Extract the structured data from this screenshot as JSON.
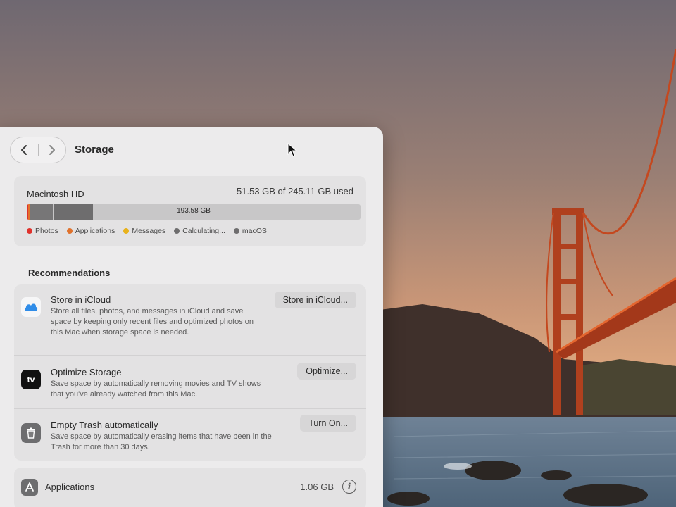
{
  "window": {
    "title": "Storage",
    "nav_back": "‹",
    "nav_forward": "›"
  },
  "disk": {
    "name": "Macintosh HD",
    "used_text": "51.53 GB of 245.11 GB used",
    "bar_label": "193.58 GB",
    "segments": [
      {
        "name": "Photos",
        "color": "#e0322c",
        "fraction": 0.004
      },
      {
        "name": "Applications",
        "color": "#e0722c",
        "fraction": 0.004
      },
      {
        "name": "Calculating…",
        "color": "#777677",
        "fraction": 0.073
      },
      {
        "name": "macOS",
        "color": "#6e6d6e",
        "fraction": 0.121
      }
    ],
    "legend": [
      {
        "label": "Photos",
        "color": "#e0322c"
      },
      {
        "label": "Applications",
        "color": "#e0722c"
      },
      {
        "label": "Messages",
        "color": "#e8b21c"
      },
      {
        "label": "Calculating...",
        "color": "#6e6d6e"
      },
      {
        "label": "macOS",
        "color": "#6e6d6e"
      }
    ]
  },
  "recommendations": {
    "title": "Recommendations",
    "items": [
      {
        "title": "Store in iCloud",
        "description": "Store all files, photos, and messages in iCloud and save space by keeping only recent files and optimized photos on this Mac when storage space is needed.",
        "button": "Store in iCloud...",
        "icon": "icloud-icon"
      },
      {
        "title": "Optimize Storage",
        "description": "Save space by automatically removing movies and TV shows that you've already watched from this Mac.",
        "button": "Optimize...",
        "icon": "apple-tv-icon",
        "icon_text": "tv"
      },
      {
        "title": "Empty Trash automatically",
        "description": "Save space by automatically erasing items that have been in the Trash for more than 30 days.",
        "button": "Turn On...",
        "icon": "trash-icon"
      }
    ]
  },
  "categories": {
    "applications": {
      "label": "Applications",
      "size": "1.06 GB",
      "icon": "app-store-icon",
      "info_glyph": "i"
    }
  }
}
